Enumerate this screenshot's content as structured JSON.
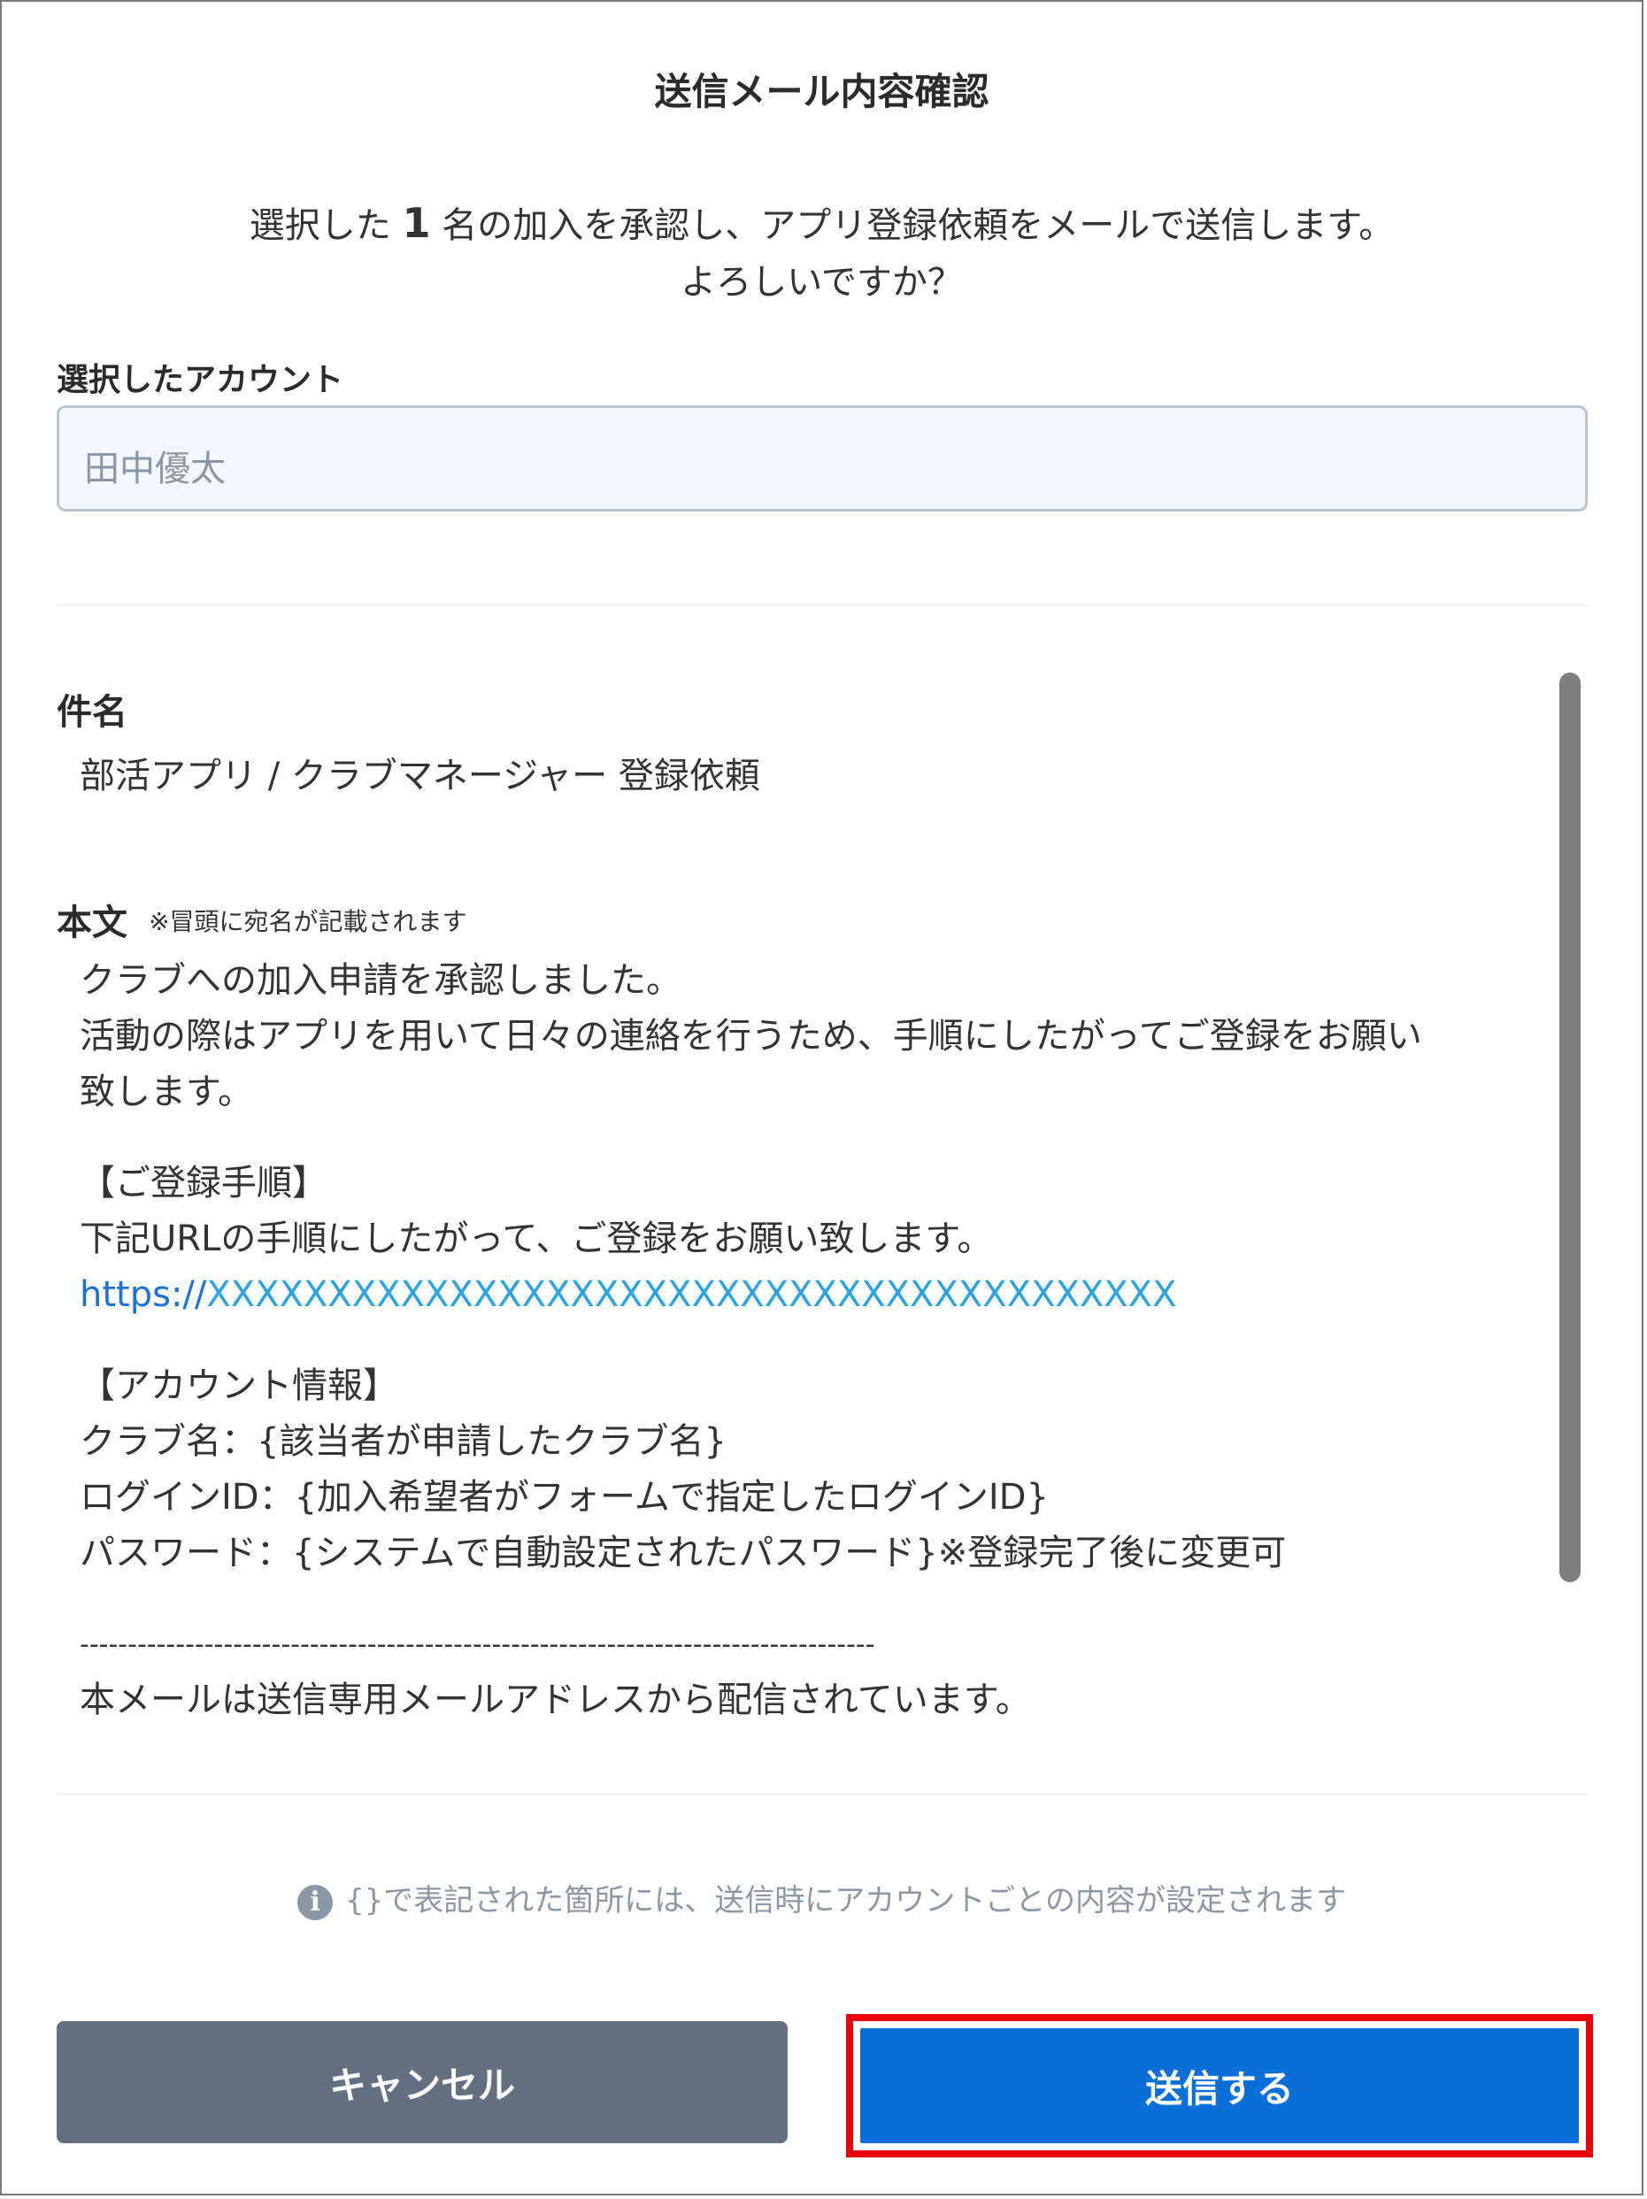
{
  "dialog": {
    "title": "送信メール内容確認",
    "intro_prefix": "選択した",
    "intro_count": "1",
    "intro_suffix": "名の加入を承認し、アプリ登録依頼をメールで送信します。",
    "intro_question": "よろしいですか？"
  },
  "account": {
    "label": "選択したアカウント",
    "value": "田中優太"
  },
  "mail": {
    "subject_label": "件名",
    "subject": "部活アプリ / クラブマネージャー 登録依頼",
    "body_label": "本文",
    "body_note": "※冒頭に宛名が記載されます",
    "body_lines": {
      "l1": "クラブへの加入申請を承認しました。",
      "l2": "活動の際はアプリを用いて日々の連絡を行うため、手順にしたがってご登録をお願い",
      "l3": "致します。",
      "l4": "【ご登録手順】",
      "l5": "下記URLの手順にしたがって、ご登録をお願い致します。",
      "url_scheme": "https://",
      "url_rest": "XXXXXXXXXXXXXXXXXXXXXXXXXXXXXXXXXXXXXXXX",
      "l6": "【アカウント情報】",
      "l7": "クラブ名：{該当者が申請したクラブ名}",
      "l8": "ログインID：{加入希望者がフォームで指定したログインID}",
      "l9": "パスワード：{システムで自動設定されたパスワード}※登録完了後に変更可",
      "l10": "-----------------------------------------------------------------------------------",
      "l11": "本メールは送信専用メールアドレスから配信されています。"
    }
  },
  "info": {
    "icon": "info-icon",
    "text": "{}で表記された箇所には、送信時にアカウントごとの内容が設定されます"
  },
  "buttons": {
    "cancel": "キャンセル",
    "send": "送信する"
  },
  "colors": {
    "primary": "#0a6fd9",
    "secondary": "#647081",
    "highlight": "#e8000b",
    "link": "#1a73d9"
  }
}
